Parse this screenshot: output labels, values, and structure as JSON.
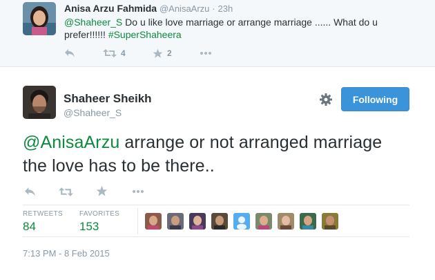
{
  "parent_tweet": {
    "name": "Anisa Arzu Fahmida",
    "screen_name": "@AnisaArzu",
    "separator": "·",
    "time": "23h",
    "mention": "@Shaheer_S",
    "text_body": " Do u like love marriage or arrange marriage ...... What do u prefer!!!!!! ",
    "hashtag": "#SuperShaheera",
    "retweet_count": "4",
    "favorite_count": "2",
    "icons": [
      "reply-icon",
      "retweet-icon",
      "star-icon",
      "more-icon"
    ]
  },
  "main_tweet": {
    "name": "Shaheer Sheikh",
    "screen_name": "@Shaheer_S",
    "follow_label": "Following",
    "mention": "@AnisaArzu",
    "text_body": " arrange or not arranged marriage the love has to be there..",
    "retweets_label": "RETWEETS",
    "retweets_count": "84",
    "favorites_label": "FAVORITES",
    "favorites_count": "153",
    "timestamp": "7:13 PM - 8 Feb 2015",
    "icons": [
      "gear-icon",
      "reply-icon",
      "retweet-icon",
      "star-icon",
      "more-icon"
    ]
  },
  "colors": {
    "link_green": "#0d8a3e",
    "follow_blue": "#3b94d9",
    "muted": "#8899a6",
    "parent_bg": "#f5f8fa"
  },
  "favoriters": [
    {
      "name": "favoriter-1"
    },
    {
      "name": "favoriter-2"
    },
    {
      "name": "favoriter-3"
    },
    {
      "name": "favoriter-4"
    },
    {
      "name": "favoriter-5"
    },
    {
      "name": "favoriter-6"
    },
    {
      "name": "favoriter-7"
    },
    {
      "name": "favoriter-8"
    },
    {
      "name": "favoriter-9"
    }
  ]
}
